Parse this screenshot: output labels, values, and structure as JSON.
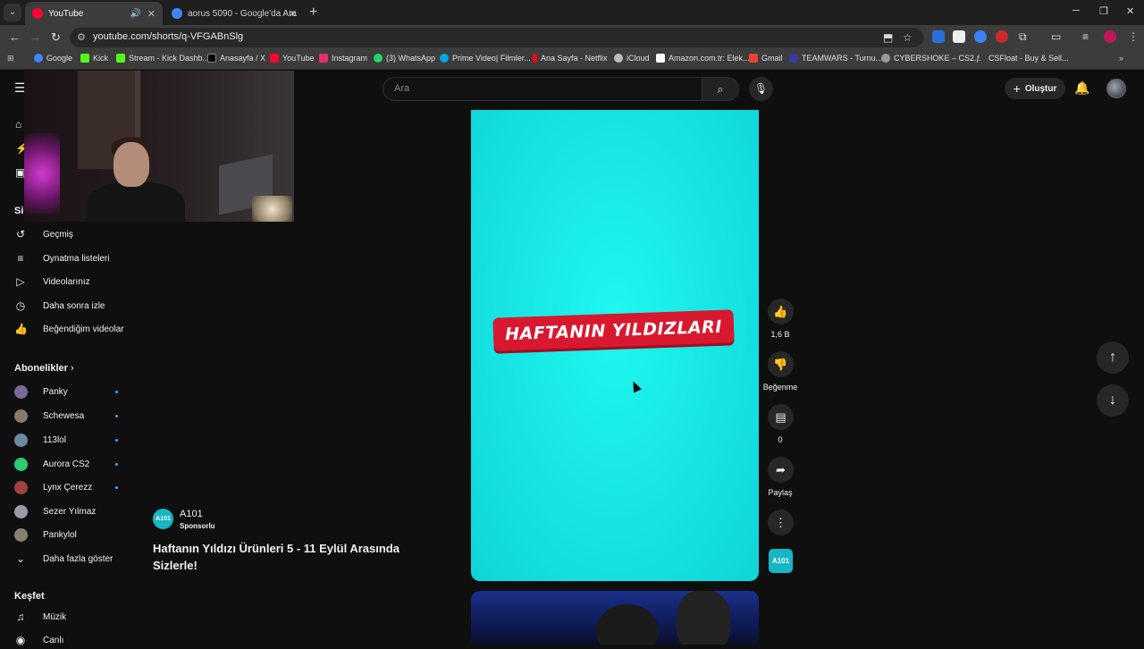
{
  "browser": {
    "tabs": [
      {
        "title": "YouTube",
        "fav_color": "#ff0033"
      },
      {
        "title": "aorus 5090 - Google'da Ara",
        "fav_color": "#4285f4"
      }
    ],
    "url": "youtube.com/shorts/q-VFGABnSlg",
    "bookmarks": [
      {
        "label": "Google",
        "color": "#4285f4"
      },
      {
        "label": "Kick",
        "color": "#53fc18"
      },
      {
        "label": "Stream - Kick Dashb...",
        "color": "#53fc18"
      },
      {
        "label": "Anasayfa / X",
        "color": "#000000"
      },
      {
        "label": "YouTube",
        "color": "#ff0033"
      },
      {
        "label": "Instagram",
        "color": "#e1306c"
      },
      {
        "label": "(3) WhatsApp",
        "color": "#25d366"
      },
      {
        "label": "Prime Video| Filmler...",
        "color": "#00a8e1"
      },
      {
        "label": "Ana Sayfa - Netflix",
        "color": "#e50914"
      },
      {
        "label": "iCloud",
        "color": "#bbbbbb"
      },
      {
        "label": "Amazon.com.tr: Elek...",
        "color": "#ffffff"
      },
      {
        "label": "Gmail",
        "color": "#ea4335"
      },
      {
        "label": "TEAMWARS - Turnu...",
        "color": "#3a3a9a"
      },
      {
        "label": "CYBERSHOKE – CS2...",
        "color": "#999999"
      },
      {
        "label": "CSFloat - Buy & Sell...",
        "color": "#dddddd"
      }
    ]
  },
  "header": {
    "search_placeholder": "Ara",
    "create_label": "Oluştur"
  },
  "sidebar": {
    "section_you_partial": "Si",
    "you_items": [
      {
        "label": "Geçmiş",
        "icon": "history-icon"
      },
      {
        "label": "Oynatma listeleri",
        "icon": "playlist-icon"
      },
      {
        "label": "Videolarınız",
        "icon": "your-videos-icon"
      },
      {
        "label": "Daha sonra izle",
        "icon": "watch-later-icon"
      },
      {
        "label": "Beğendiğim videolar",
        "icon": "liked-icon"
      }
    ],
    "subscriptions_title": "Abonelikler",
    "subscriptions": [
      {
        "label": "Panky",
        "color": "#7a6a9a"
      },
      {
        "label": "Schewesa",
        "color": "#8a7a6a"
      },
      {
        "label": "113lol",
        "color": "#6a8aa0"
      },
      {
        "label": "Aurora CS2",
        "color": "#2ecc71"
      },
      {
        "label": "Lynx Çerezz",
        "color": "#a04040"
      },
      {
        "label": "Sezer Yılmaz",
        "color": "#9a9aaa"
      },
      {
        "label": "Pankylol",
        "color": "#8a8070"
      }
    ],
    "show_more": "Daha fazla göster",
    "explore_title": "Keşfet",
    "explore_items": [
      {
        "label": "Müzik",
        "icon": "music-icon"
      },
      {
        "label": "Canlı",
        "icon": "live-icon"
      }
    ]
  },
  "short": {
    "banner_text": "HAFTANIN YILDIZLARI",
    "bg_color": "#1ef7ef",
    "likes": "1,6 B",
    "dislike_label": "Beğenme",
    "comments": "0",
    "share_label": "Paylaş",
    "channel_thumb_text": "A101"
  },
  "sponsor": {
    "logo_text": "A101",
    "name": "A101",
    "tag": "Sponsorlu",
    "title": "Haftanın Yıldızı Ürünleri 5 - 11 Eylül Arasında Sizlerle!"
  }
}
